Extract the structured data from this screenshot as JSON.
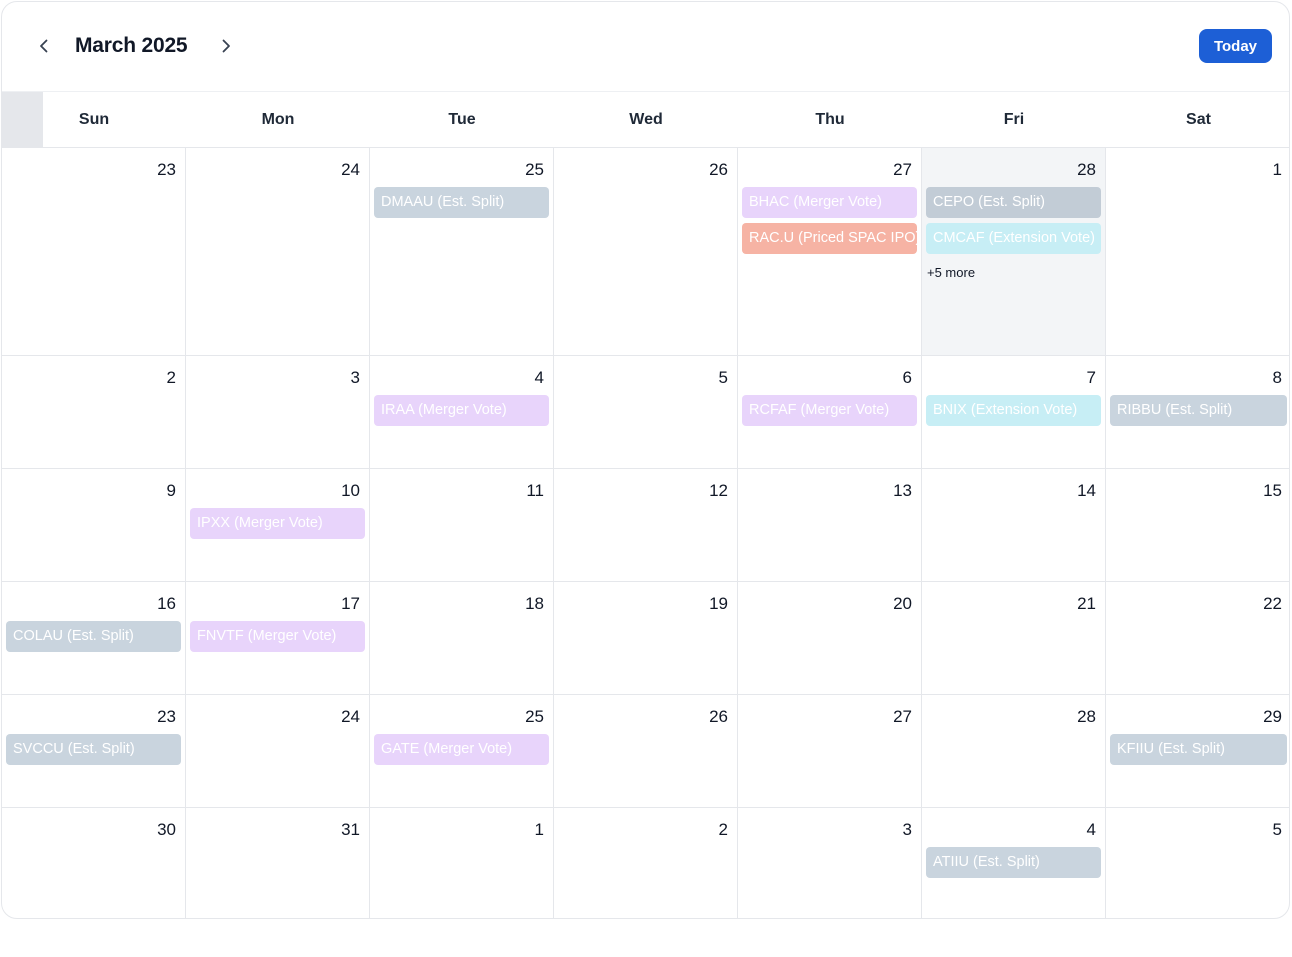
{
  "header": {
    "month_title": "March 2025",
    "today_label": "Today",
    "prev_icon": "chevron-left-icon",
    "next_icon": "chevron-right-icon",
    "accent": "#1d5fd6"
  },
  "days_of_week": [
    "Sun",
    "Mon",
    "Tue",
    "Wed",
    "Thu",
    "Fri",
    "Sat"
  ],
  "event_colors": {
    "Est. Split": "#c9d4de",
    "Merger Vote": "#e8d4fb",
    "Priced SPAC IPO": "#f6b3a4",
    "Extension Vote": "#c7eef5"
  },
  "weeks": [
    {
      "days": [
        {
          "num": "23",
          "events": []
        },
        {
          "num": "24",
          "events": []
        },
        {
          "num": "25",
          "events": [
            {
              "label": "DMAAU (Est. Split)",
              "kind": "est-split"
            }
          ]
        },
        {
          "num": "26",
          "events": []
        },
        {
          "num": "27",
          "events": [
            {
              "label": "BHAC (Merger Vote)",
              "kind": "merger"
            },
            {
              "label": "RAC.U (Priced SPAC IPO)",
              "kind": "priced"
            }
          ]
        },
        {
          "num": "28",
          "highlight": true,
          "events": [
            {
              "label": "CEPO (Est. Split)",
              "kind": "est-split dark"
            },
            {
              "label": "CMCAF (Extension Vote)",
              "kind": "extension"
            }
          ],
          "more": "+5 more"
        },
        {
          "num": "1",
          "events": []
        }
      ]
    },
    {
      "days": [
        {
          "num": "2",
          "events": []
        },
        {
          "num": "3",
          "events": []
        },
        {
          "num": "4",
          "events": [
            {
              "label": "IRAA (Merger Vote)",
              "kind": "merger"
            }
          ]
        },
        {
          "num": "5",
          "events": []
        },
        {
          "num": "6",
          "events": [
            {
              "label": "RCFAF (Merger Vote)",
              "kind": "merger"
            }
          ]
        },
        {
          "num": "7",
          "events": [
            {
              "label": "BNIX (Extension Vote)",
              "kind": "extension"
            }
          ]
        },
        {
          "num": "8",
          "events": [
            {
              "label": "RIBBU (Est. Split)",
              "kind": "est-split"
            }
          ]
        }
      ]
    },
    {
      "days": [
        {
          "num": "9",
          "events": []
        },
        {
          "num": "10",
          "events": [
            {
              "label": "IPXX (Merger Vote)",
              "kind": "merger"
            }
          ]
        },
        {
          "num": "11",
          "events": []
        },
        {
          "num": "12",
          "events": []
        },
        {
          "num": "13",
          "events": []
        },
        {
          "num": "14",
          "events": []
        },
        {
          "num": "15",
          "events": []
        }
      ]
    },
    {
      "days": [
        {
          "num": "16",
          "events": [
            {
              "label": "COLAU (Est. Split)",
              "kind": "est-split"
            }
          ]
        },
        {
          "num": "17",
          "events": [
            {
              "label": "FNVTF (Merger Vote)",
              "kind": "merger"
            }
          ]
        },
        {
          "num": "18",
          "events": []
        },
        {
          "num": "19",
          "events": []
        },
        {
          "num": "20",
          "events": []
        },
        {
          "num": "21",
          "events": []
        },
        {
          "num": "22",
          "events": []
        }
      ]
    },
    {
      "days": [
        {
          "num": "23",
          "events": [
            {
              "label": "SVCCU (Est. Split)",
              "kind": "est-split"
            }
          ]
        },
        {
          "num": "24",
          "events": []
        },
        {
          "num": "25",
          "events": [
            {
              "label": "GATE (Merger Vote)",
              "kind": "merger"
            }
          ]
        },
        {
          "num": "26",
          "events": []
        },
        {
          "num": "27",
          "events": []
        },
        {
          "num": "28",
          "events": []
        },
        {
          "num": "29",
          "events": [
            {
              "label": "KFIIU (Est. Split)",
              "kind": "est-split"
            }
          ]
        }
      ]
    },
    {
      "days": [
        {
          "num": "30",
          "events": []
        },
        {
          "num": "31",
          "events": []
        },
        {
          "num": "1",
          "events": []
        },
        {
          "num": "2",
          "events": []
        },
        {
          "num": "3",
          "events": []
        },
        {
          "num": "4",
          "events": [
            {
              "label": "ATIIU (Est. Split)",
              "kind": "est-split"
            }
          ]
        },
        {
          "num": "5",
          "events": []
        }
      ]
    }
  ]
}
